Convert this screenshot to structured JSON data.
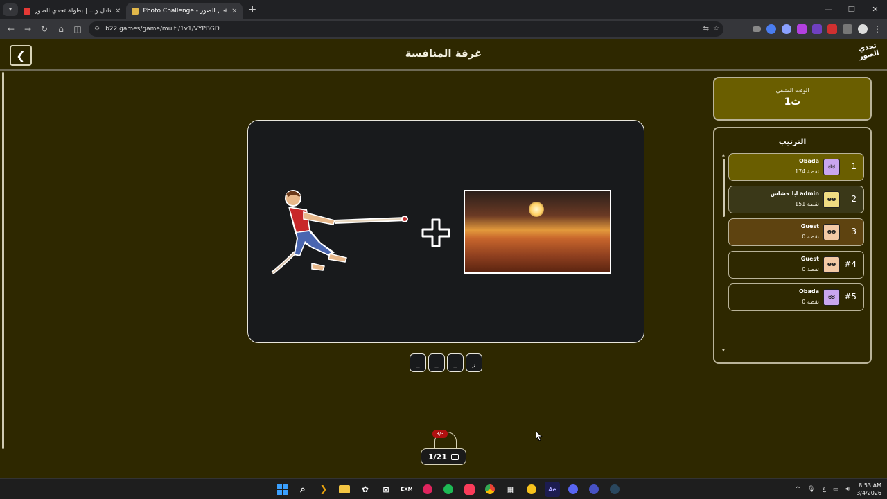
{
  "browser": {
    "tabs": [
      {
        "title": "عادل و... | بطولة تحدي الصور 🌙",
        "active": false,
        "favicon_color": "#e53935"
      },
      {
        "title": "Photo Challenge - تحدي الصور",
        "active": true,
        "favicon_color": "#e2b84a"
      }
    ],
    "url": "b22.games/game/multi/1v1/VYPBGD"
  },
  "header": {
    "title": "غرفة المنافسة",
    "logo_line1": "تحدي",
    "logo_line2": "الصور"
  },
  "time_panel": {
    "label": "الوقت المتبقي",
    "value": "1ث"
  },
  "ranking": {
    "title": "الترتيب",
    "players": [
      {
        "pos": "1",
        "name": "Obada",
        "points": "174 نقطة",
        "bg": "#6a5e00",
        "avatar_bg": "#c9a6f0"
      },
      {
        "pos": "2",
        "name": "ابا حشاش admin",
        "points": "151 نقطة",
        "bg": "#3a3818",
        "avatar_bg": "#f0dc82"
      },
      {
        "pos": "3",
        "name": "Guest",
        "points": "0 نقطة",
        "bg": "#5e4310",
        "avatar_bg": "#f3c9a6"
      },
      {
        "pos": "#4",
        "name": "Guest",
        "points": "0 نقطة",
        "bg": "#2e2800",
        "avatar_bg": "#f3c9a6"
      },
      {
        "pos": "#5",
        "name": "Obada",
        "points": "0 نقطة",
        "bg": "#2e2800",
        "avatar_bg": "#c9a6f0"
      }
    ]
  },
  "answer_slots": [
    "_",
    "_",
    "_",
    "ر"
  ],
  "lives": "3/3",
  "round_counter": "1/21",
  "taskbar": {
    "time": "8:53 AM",
    "date": "3/4/2026",
    "lang": "ع"
  }
}
